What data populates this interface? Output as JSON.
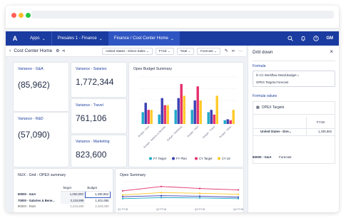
{
  "browser": {
    "dots": [
      "#ff5f57",
      "#febc2e",
      "#28c840"
    ]
  },
  "nav": {
    "logo": "A",
    "items": [
      "Apps",
      "Presales 1 - Finance",
      "Finance / Cost Center Home"
    ],
    "user_initials": "GM"
  },
  "page": {
    "title": "Cost Center Home",
    "filters": [
      "United States - Direct Sales",
      "FY18",
      "Total",
      "Forecast"
    ],
    "more": "···"
  },
  "kpis": [
    {
      "label": "Variance - G&A",
      "value": "(85,962)"
    },
    {
      "label": "Variance - R&D",
      "value": "(57,090)"
    },
    {
      "label": "Variance - Salaries",
      "value": "1,772,344"
    },
    {
      "label": "Variance - Travel",
      "value": "761,106"
    },
    {
      "label": "Variance - Marketing",
      "value": "823,600"
    }
  ],
  "opex_budget": {
    "title": "Opex Budget Summary",
    "colors": [
      "#1fa9c7",
      "#3b3fb3",
      "#e4306b",
      "#ffca28"
    ]
  },
  "nux_grid": {
    "title": "NUX - Grid - OPEX summary",
    "columns": [
      "Target",
      "Budget"
    ],
    "rows": [
      {
        "label": "60000 - G&A",
        "target": "1,250,000",
        "budget": "1,335,962"
      },
      {
        "label": "70000 - Salaries & Bene...",
        "target": "3,119,999",
        "budget": "1,401,655"
      },
      {
        "label": "80000 - R&D",
        "target": "2,223,280",
        "budget": "2,333,000"
      }
    ]
  },
  "opex_summary": {
    "title": "Opex Summary",
    "x_ticks": [
      "Q1 FY18",
      "Q2 FY18",
      "Q3 FY18",
      "Q4 FY18"
    ]
  },
  "chart_data": [
    {
      "type": "bar",
      "title": "Opex Budget Summary",
      "categories": [
        "Budget - G&A",
        "Budget - Salaries & Benefits",
        "Budget - Marketing",
        "Budget - R&D",
        "Budget - Travel",
        "Budget - Other"
      ],
      "series": [
        {
          "name": "FY Target",
          "values": [
            0.25,
            0.2,
            0.3,
            0.3,
            0.25,
            0.08
          ]
        },
        {
          "name": "FY Plan",
          "values": [
            0.45,
            0.55,
            0.55,
            0.5,
            0.3,
            0.1
          ]
        },
        {
          "name": "CY Target",
          "values": [
            0.3,
            0.4,
            0.85,
            0.8,
            0.2,
            0.08
          ]
        },
        {
          "name": "CY LE",
          "values": [
            0.3,
            0.4,
            0.6,
            0.5,
            0.6,
            0.3
          ]
        }
      ],
      "xlabel": "",
      "ylabel": "",
      "legend": "bottom"
    },
    {
      "type": "line",
      "title": "Opex Summary",
      "categories": [
        "Q1 FY18",
        "Q2 FY18",
        "Q3 FY18",
        "Q4 FY18"
      ],
      "series": [
        {
          "color": "#e4306b",
          "values": [
            0.62,
            0.8,
            0.72,
            0.66
          ]
        },
        {
          "color": "#ffca28",
          "values": [
            0.45,
            0.55,
            0.52,
            0.48
          ]
        },
        {
          "color": "#3b3fb3",
          "values": [
            0.38,
            0.42,
            0.4,
            0.36
          ]
        },
        {
          "color": "#1fa9c7",
          "values": [
            0.3,
            0.34,
            0.33,
            0.3
          ]
        }
      ]
    }
  ],
  "drill": {
    "title": "Drill down",
    "formula_label": "Formula",
    "formula_lines": [
      "fx  CC Workflow Detail.Budget =",
      "OPEX Targets.Forecast"
    ],
    "formula_values_label": "Formula values",
    "module_name": "OPEX Targets",
    "col_header": "FY18",
    "row_label": "United States - Dire...",
    "row_value": "1,335,962",
    "bottom_label": "60000 - G&A",
    "bottom_value": "Forecast"
  }
}
